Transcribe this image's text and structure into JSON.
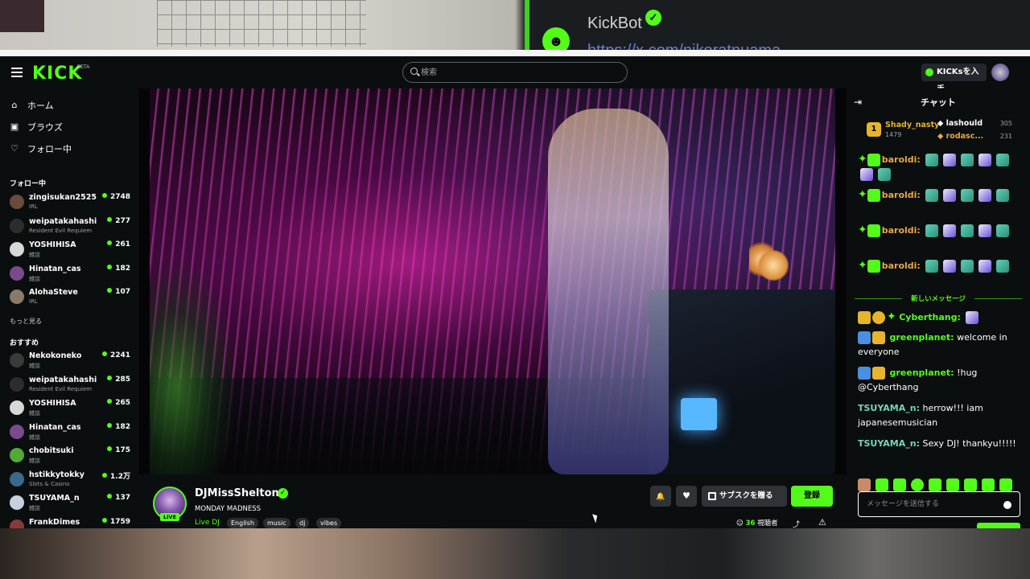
{
  "overlay": {
    "kickbot_name": "KickBot",
    "kickbot_verified": "✓",
    "kickbot_avatar": "☻",
    "kickbot_link": "https://x.com/nikoratnuama"
  },
  "header": {
    "logo": "KICK",
    "beta": "BETA",
    "search_placeholder": "検索",
    "kicks_button": "KICKsを入手"
  },
  "sidebar": {
    "nav": [
      {
        "icon": "⌂",
        "label": "ホーム"
      },
      {
        "icon": "▣",
        "label": "ブラウズ"
      },
      {
        "icon": "♡",
        "label": "フォロー中"
      }
    ],
    "following_title": "フォロー中",
    "following": [
      {
        "name": "zingisukan2525",
        "category": "IRL",
        "viewers": "2748",
        "color": "#6b4b3a"
      },
      {
        "name": "weipatakahashi",
        "category": "Resident Evil Requiem",
        "viewers": "277",
        "color": "#2d2d2d"
      },
      {
        "name": "YOSHIHISA",
        "category": "雑談",
        "viewers": "261",
        "color": "#d8d8d8"
      },
      {
        "name": "Hinatan_cas",
        "category": "雑談",
        "viewers": "182",
        "color": "#7a4a8a"
      },
      {
        "name": "AlohaSteve",
        "category": "IRL",
        "viewers": "107",
        "color": "#8a7a6a"
      }
    ],
    "show_more": "もっと見る",
    "recommended_title": "おすすめ",
    "recommended": [
      {
        "name": "Nekokoneko",
        "category": "雑談",
        "viewers": "2241",
        "color": "#3a3a3a"
      },
      {
        "name": "weipatakahashi",
        "category": "Resident Evil Requiem",
        "viewers": "285",
        "color": "#2d2d2d"
      },
      {
        "name": "YOSHIHISA",
        "category": "雑談",
        "viewers": "265",
        "color": "#d8d8d8"
      },
      {
        "name": "Hinatan_cas",
        "category": "雑談",
        "viewers": "182",
        "color": "#7a4a8a"
      },
      {
        "name": "chobitsuki",
        "category": "雑談",
        "viewers": "175",
        "color": "#53a83a"
      },
      {
        "name": "hstikkytokky",
        "category": "Slots & Casino",
        "viewers": "1.2万",
        "color": "#3a6a8a"
      },
      {
        "name": "TSUYAMA_n",
        "category": "雑談",
        "viewers": "137",
        "color": "#c8d0e0"
      },
      {
        "name": "FrankDimes",
        "category": "",
        "viewers": "1759",
        "color": "#8a3a3a"
      }
    ]
  },
  "stream": {
    "streamer": "DJMissShelton",
    "verified": "✓",
    "title": "MONDAY MADNESS",
    "category": "Live DJ",
    "tags": [
      "English",
      "music",
      "dj",
      "vibes"
    ],
    "live": "LIVE",
    "gift_button": "サブスクを贈る",
    "subscribe_button": "登録",
    "viewer_count": "36",
    "viewer_label": "視聴者",
    "bell_icon": "🔔",
    "heart_icon": "♥",
    "share_icon": "⤴",
    "report_icon": "⚠"
  },
  "chat": {
    "title": "チャット",
    "leaderboard": [
      {
        "rank": "1",
        "name": "Shady_nasty",
        "count": "1479"
      },
      {
        "name": "lashould",
        "count": "305"
      },
      {
        "name": "rodasc...",
        "count": "231"
      }
    ],
    "spam_user": "baroldi:",
    "new_messages": "新しいメッセージ",
    "messages": [
      {
        "user": "Cyberthang:",
        "text": ""
      },
      {
        "user": "greenplanet:",
        "text": "welcome in everyone"
      },
      {
        "user": "greenplanet:",
        "text": "!hug @Cyberthang"
      },
      {
        "user": "TSUYAMA_n:",
        "text": "herrow!!! iam japanesemusician"
      },
      {
        "user": "TSUYAMA_n:",
        "text": "Sexy DJ! thankyu!!!!!"
      }
    ],
    "input_placeholder": "メッセージを送信する"
  },
  "colors": {
    "brand": "#53fc18",
    "background": "#0b0e0f"
  }
}
